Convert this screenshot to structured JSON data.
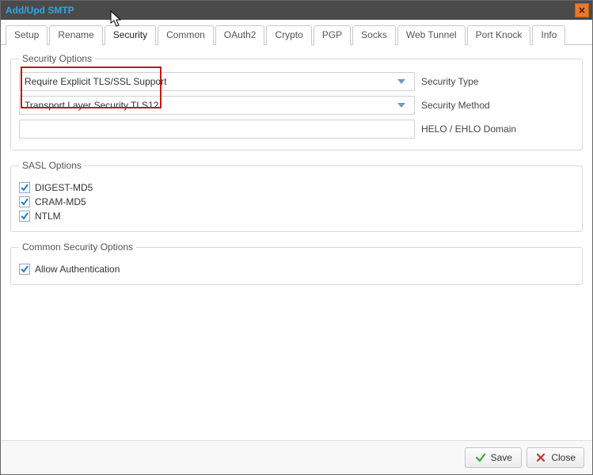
{
  "window": {
    "title": "Add/Upd SMTP"
  },
  "tabs": {
    "items": [
      {
        "label": "Setup"
      },
      {
        "label": "Rename"
      },
      {
        "label": "Security"
      },
      {
        "label": "Common"
      },
      {
        "label": "OAuth2"
      },
      {
        "label": "Crypto"
      },
      {
        "label": "PGP"
      },
      {
        "label": "Socks"
      },
      {
        "label": "Web Tunnel"
      },
      {
        "label": "Port Knock"
      },
      {
        "label": "Info"
      }
    ],
    "active_index": 2
  },
  "security_options": {
    "legend": "Security Options",
    "security_type": {
      "value": "Require Explicit TLS/SSL Support",
      "label": "Security Type"
    },
    "security_method": {
      "value": "Transport Layer Security TLS12",
      "label": "Security Method"
    },
    "helo_domain": {
      "value": "",
      "label": "HELO / EHLO Domain"
    }
  },
  "sasl_options": {
    "legend": "SASL Options",
    "items": [
      {
        "label": "DIGEST-MD5",
        "checked": true
      },
      {
        "label": "CRAM-MD5",
        "checked": true
      },
      {
        "label": "NTLM",
        "checked": true
      }
    ]
  },
  "common_security_options": {
    "legend": "Common Security Options",
    "items": [
      {
        "label": "Allow Authentication",
        "checked": true
      }
    ]
  },
  "footer": {
    "save_label": "Save",
    "close_label": "Close"
  }
}
